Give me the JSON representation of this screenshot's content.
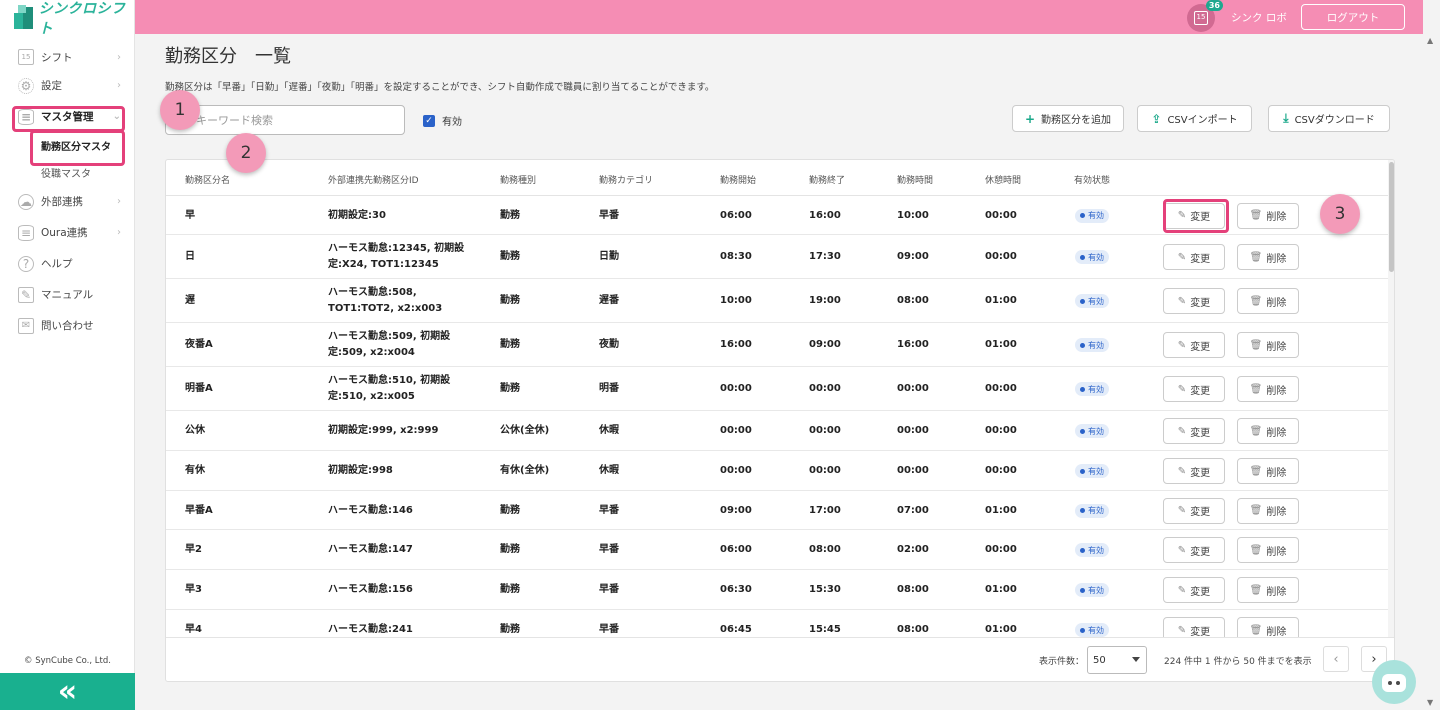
{
  "app": {
    "logo_text": "シンクロシフト"
  },
  "sidebar": {
    "items": [
      {
        "label": "シフト",
        "icon": "calendar-icon"
      },
      {
        "label": "設定",
        "icon": "gear-icon"
      },
      {
        "label": "マスタ管理",
        "icon": "database-icon"
      },
      {
        "label": "外部連携",
        "icon": "cloud-icon"
      },
      {
        "label": "Oura連携",
        "icon": "database-icon"
      },
      {
        "label": "ヘルプ",
        "icon": "question-icon"
      },
      {
        "label": "マニュアル",
        "icon": "pen-icon"
      },
      {
        "label": "問い合わせ",
        "icon": "mail-icon"
      }
    ],
    "sub_items": [
      {
        "label": "勤務区分マスタ"
      },
      {
        "label": "役職マスタ"
      }
    ],
    "copyright": "© SynCube Co., Ltd.",
    "collapse_glyph": "«"
  },
  "header": {
    "calendar_day": "15",
    "notification_count": "36",
    "user_name": "シンク ロボ",
    "logout_label": "ログアウト"
  },
  "page": {
    "title": "勤務区分　一覧",
    "description": "勤務区分は「早番」「日勤」「遅番」「夜勤」「明番」を設定することができ、シフト自動作成で職員に割り当てることができます。"
  },
  "toolbar": {
    "search_placeholder": "キーワード検索",
    "active_filter_label": "有効",
    "add_label": "勤務区分を追加",
    "import_label": "CSVインポート",
    "download_label": "CSVダウンロード"
  },
  "callouts": [
    "1",
    "2",
    "3"
  ],
  "table": {
    "headers": [
      "勤務区分名",
      "外部連携先勤務区分ID",
      "勤務種別",
      "勤務カテゴリ",
      "勤務開始",
      "勤務終了",
      "勤務時間",
      "休憩時間",
      "有効状態"
    ],
    "edit_label": "変更",
    "delete_label": "削除",
    "rows": [
      {
        "name": "早",
        "ext_id": "初期設定:30",
        "type": "勤務",
        "category": "早番",
        "start": "06:00",
        "end": "16:00",
        "duration": "10:00",
        "break": "00:00",
        "status": "有効"
      },
      {
        "name": "日",
        "ext_id": "ハーモス勤怠:12345, 初期設定:X24, TOT1:12345",
        "type": "勤務",
        "category": "日勤",
        "start": "08:30",
        "end": "17:30",
        "duration": "09:00",
        "break": "00:00",
        "status": "有効"
      },
      {
        "name": "遅",
        "ext_id": "ハーモス勤怠:508, TOT1:TOT2, x2:x003",
        "type": "勤務",
        "category": "遅番",
        "start": "10:00",
        "end": "19:00",
        "duration": "08:00",
        "break": "01:00",
        "status": "有効"
      },
      {
        "name": "夜番A",
        "ext_id": "ハーモス勤怠:509, 初期設定:509, x2:x004",
        "type": "勤務",
        "category": "夜勤",
        "start": "16:00",
        "end": "09:00",
        "duration": "16:00",
        "break": "01:00",
        "status": "有効"
      },
      {
        "name": "明番A",
        "ext_id": "ハーモス勤怠:510, 初期設定:510, x2:x005",
        "type": "勤務",
        "category": "明番",
        "start": "00:00",
        "end": "00:00",
        "duration": "00:00",
        "break": "00:00",
        "status": "有効"
      },
      {
        "name": "公休",
        "ext_id": "初期設定:999, x2:999",
        "type": "公休(全休)",
        "category": "休暇",
        "start": "00:00",
        "end": "00:00",
        "duration": "00:00",
        "break": "00:00",
        "status": "有効"
      },
      {
        "name": "有休",
        "ext_id": "初期設定:998",
        "type": "有休(全休)",
        "category": "休暇",
        "start": "00:00",
        "end": "00:00",
        "duration": "00:00",
        "break": "00:00",
        "status": "有効"
      },
      {
        "name": "早番A",
        "ext_id": "ハーモス勤怠:146",
        "type": "勤務",
        "category": "早番",
        "start": "09:00",
        "end": "17:00",
        "duration": "07:00",
        "break": "01:00",
        "status": "有効"
      },
      {
        "name": "早2",
        "ext_id": "ハーモス勤怠:147",
        "type": "勤務",
        "category": "早番",
        "start": "06:00",
        "end": "08:00",
        "duration": "02:00",
        "break": "00:00",
        "status": "有効"
      },
      {
        "name": "早3",
        "ext_id": "ハーモス勤怠:156",
        "type": "勤務",
        "category": "早番",
        "start": "06:30",
        "end": "15:30",
        "duration": "08:00",
        "break": "01:00",
        "status": "有効"
      },
      {
        "name": "早4",
        "ext_id": "ハーモス勤怠:241",
        "type": "勤務",
        "category": "早番",
        "start": "06:45",
        "end": "15:45",
        "duration": "08:00",
        "break": "01:00",
        "status": "有効"
      }
    ]
  },
  "pagination": {
    "per_page_label": "表示件数：",
    "per_page_value": "50",
    "range_text": "224 件中 1 件から 50 件までを表示",
    "prev_glyph": "‹",
    "next_glyph": "›"
  },
  "colors": {
    "header": "#f58db4",
    "accent": "#19b08f",
    "highlight": "#e4407a",
    "status": "#2a62c9"
  }
}
